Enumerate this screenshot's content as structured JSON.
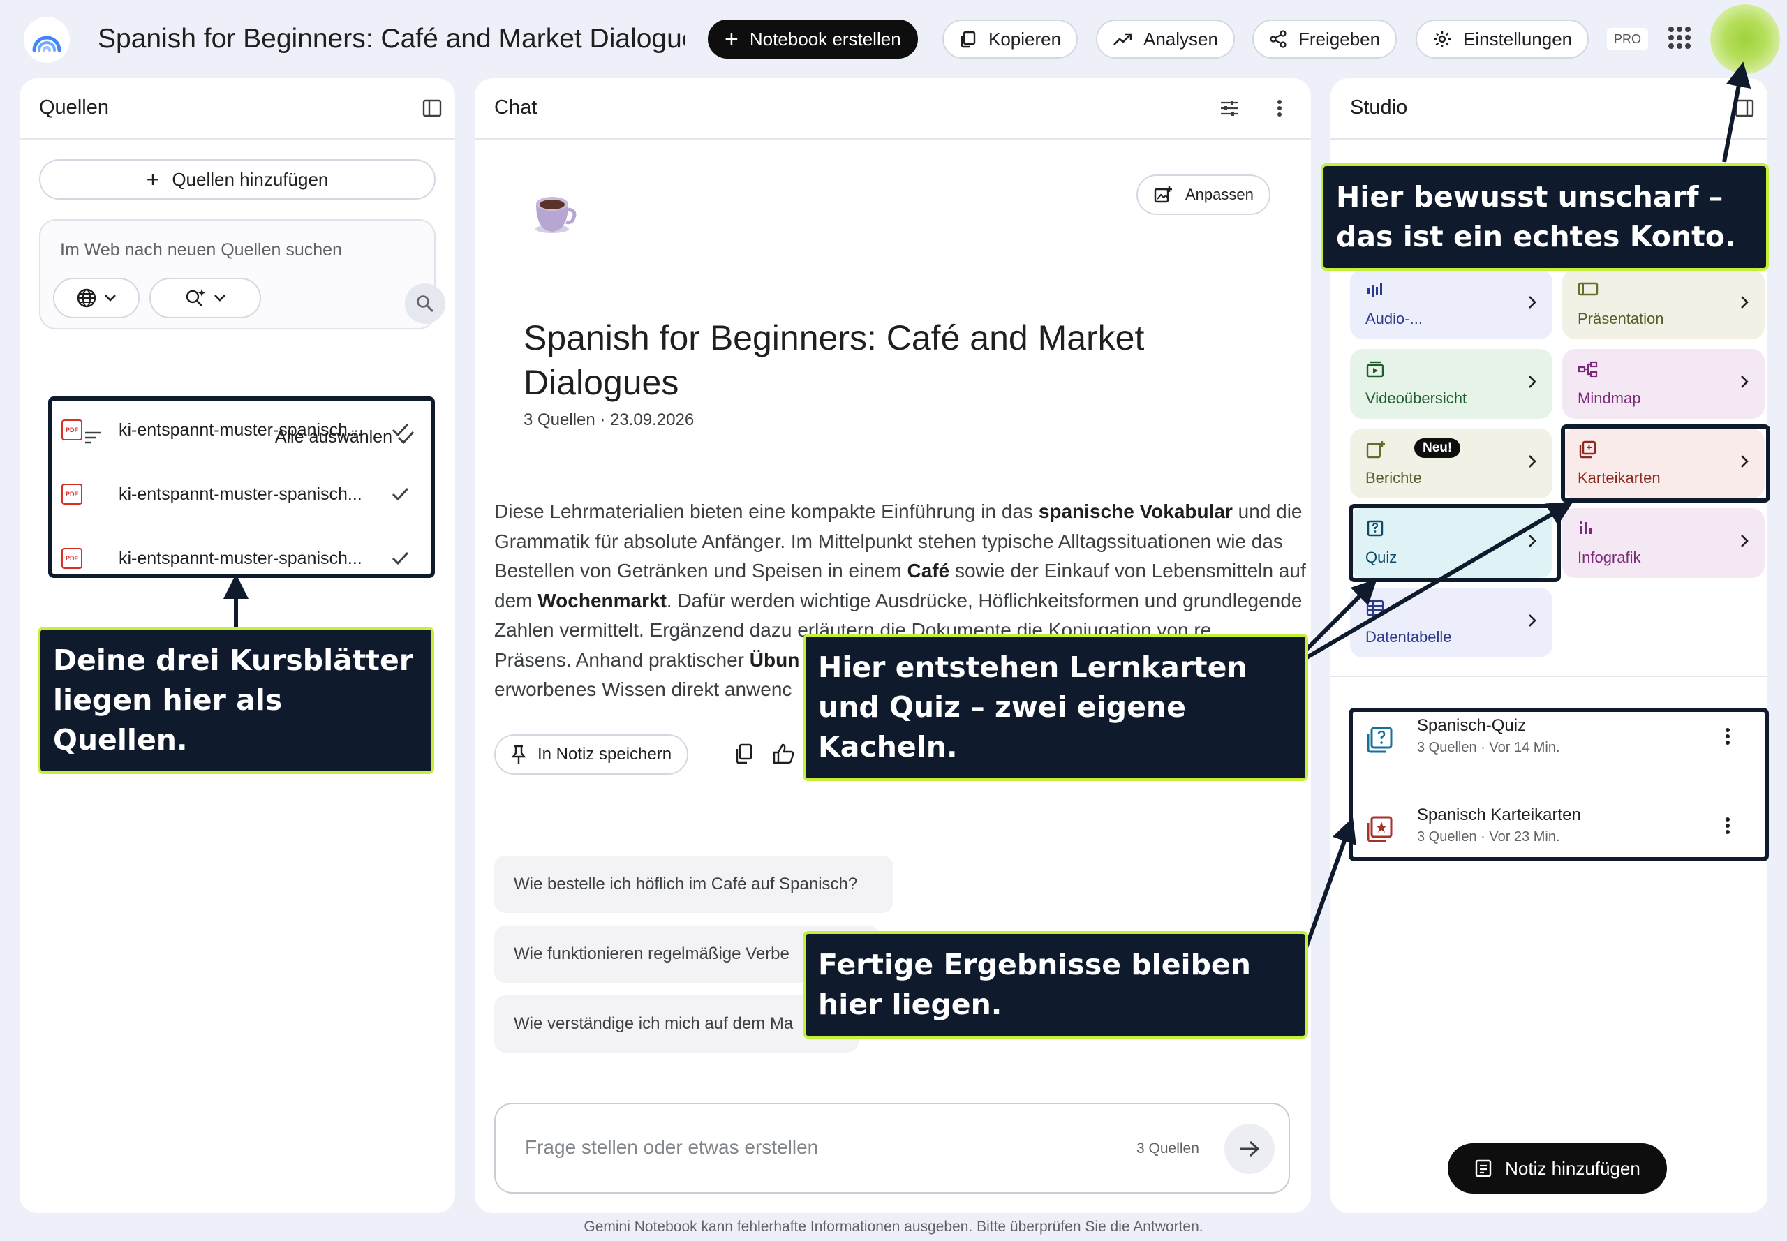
{
  "topbar": {
    "title": "Spanish for Beginners: Café and Market Dialogues",
    "create_label": "Notebook erstellen",
    "copy_label": "Kopieren",
    "analytics_label": "Analysen",
    "share_label": "Freigeben",
    "settings_label": "Einstellungen",
    "pro_badge": "PRO"
  },
  "sources": {
    "title": "Quellen",
    "add_label": "Quellen hinzufügen",
    "search_placeholder": "Im Web nach neuen Quellen suchen",
    "select_all_label": "Alle auswählen",
    "items": [
      {
        "name": "ki-entspannt-muster-spanisch...",
        "icon": "pdf-icon",
        "checked": true
      },
      {
        "name": "ki-entspannt-muster-spanisch...",
        "icon": "pdf-icon",
        "checked": true
      },
      {
        "name": "ki-entspannt-muster-spanisch...",
        "icon": "pdf-icon",
        "checked": true
      }
    ]
  },
  "chat": {
    "title": "Chat",
    "customize_label": "Anpassen",
    "notebook_title": "Spanish for Beginners: Café and Market Dialogues",
    "meta": "3 Quellen · 23.09.2026",
    "summary": {
      "p1": "Diese Lehrmaterialien bieten eine kompakte Einführung in das ",
      "b1": "spanische Vokabular",
      "p2": " und die Grammatik für absolute Anfänger. Im Mittelpunkt stehen typische Alltagssituationen wie das Bestellen von Getränken und Speisen in einem ",
      "b2": "Café",
      "p3": " sowie der Einkauf von Lebensmitteln auf dem ",
      "b3": "Wochenmarkt",
      "p4": ". Dafür werden wichtige Ausdrücke, Höflichkeitsformen und grundlegende Zahlen vermittelt. Ergänzend dazu erläutern die Dokumente die Konjugation von re",
      "p5": " Präsens. Anhand praktischer ",
      "b4": "Übun",
      "p6": " erworbenes Wissen direkt anwenc"
    },
    "save_note_label": "In Notiz speichern",
    "suggestions": [
      "Wie bestelle ich höflich im Café auf Spanisch?",
      "Wie funktionieren regelmäßige Verbe",
      "Wie verständige ich mich auf dem Ma"
    ],
    "input_placeholder": "Frage stellen oder etwas erstellen",
    "input_sources": "3 Quellen"
  },
  "studio": {
    "title": "Studio",
    "tiles": [
      {
        "label": "Audio-...",
        "icon": "audio-wave-icon",
        "color": "#eceffb"
      },
      {
        "label": "Präsentation",
        "icon": "slides-icon",
        "color": "#f1f1e6"
      },
      {
        "label": "Videoübersicht",
        "icon": "video-icon",
        "color": "#e6f3e8"
      },
      {
        "label": "Mindmap",
        "icon": "mindmap-icon",
        "color": "#f3e8f3"
      },
      {
        "label": "Berichte",
        "icon": "report-icon",
        "color": "#f1f1e6",
        "badge": "Neu!"
      },
      {
        "label": "Karteikarten",
        "icon": "flashcards-icon",
        "color": "#f8ebe9"
      },
      {
        "label": "Quiz",
        "icon": "quiz-icon",
        "color": "#dff3f6"
      },
      {
        "label": "Infografik",
        "icon": "infographic-icon",
        "color": "#f3e8f3"
      },
      {
        "label": "Datentabelle",
        "icon": "table-icon",
        "color": "#eceffb"
      }
    ],
    "results": [
      {
        "title": "Spanisch-Quiz",
        "meta": "3 Quellen · Vor 14 Min.",
        "icon": "quiz-icon"
      },
      {
        "title": "Spanisch Karteikarten",
        "meta": "3 Quellen · Vor 23 Min.",
        "icon": "flashcards-icon"
      }
    ],
    "add_note_label": "Notiz hinzufügen"
  },
  "footer": "Gemini Notebook kann fehlerhafte Informationen ausgeben. Bitte überprüfen Sie die Antworten.",
  "annotations": {
    "account": "Hier bewusst unscharf – das ist ein echtes Konto.",
    "sources": "Deine drei Kursblätter liegen hier als Quellen.",
    "tiles": "Hier entstehen Lernkarten und Quiz – zwei eigene Kacheln.",
    "results": "Fertige Ergebnisse bleiben hier liegen."
  },
  "colors": {
    "annotation_bg": "#0f1b2d",
    "annotation_border": "#c6ef3a",
    "page_bg": "#eef0f9"
  }
}
